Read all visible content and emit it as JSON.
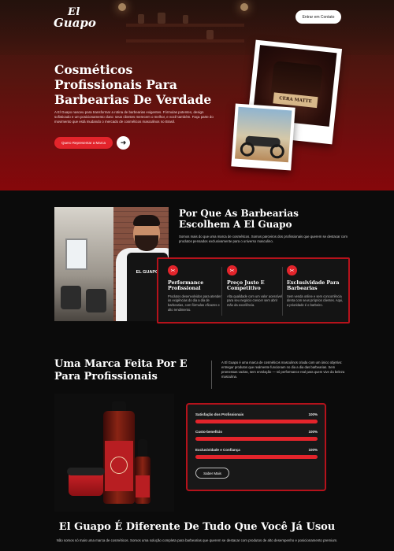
{
  "header": {
    "logo_top": "El",
    "logo_bottom": "Guapo",
    "contact_button": "Entrar em Contato"
  },
  "hero": {
    "title": "Cosméticos Profissionais Para Barbearias De Verdade",
    "text": "A El Guapo nasceu para transformar a rotina de barbearias exigentes. Fórmulas potentes, design sofisticado e um posicionamento claro: seus clientes merecem o melhor, e você também. Faça parte do movimento que está mudando o mercado de cosméticos masculinos no Brasil.",
    "cta_button": "Quero Representar a Marca",
    "arrow_icon": "arrow-right-icon",
    "product_label": "CERA MATTE"
  },
  "why": {
    "title": "Por Que As Barbearias Escolhem A El Guapo",
    "text": "Somos mais do que uma marca de cosméticos. Somos parceiros dos profissionais que querem se destacar com produtos pensados exclusivamente para o universo masculino.",
    "apron_text": "EL GUAPO",
    "features": [
      {
        "icon": "scissors-icon",
        "title": "Performance Profissional",
        "text": "Produtos desenvolvidos para atender às exigências do dia a dia de barbearias, com fórmulas eficazes e alto rendimento."
      },
      {
        "icon": "scissors-icon",
        "title": "Preço Justo E Competitivo",
        "text": "Alta qualidade com um valor acessível para seu negócio crescer sem abrir mão da excelência."
      },
      {
        "icon": "scissors-icon",
        "title": "Exclusividade Para Barbearias",
        "text": "Sem venda online e sem concorrência direta com seus próprios clientes. Aqui, a prioridade é o barbeiro."
      }
    ]
  },
  "brand": {
    "title": "Uma Marca Feita Por E Para Profissionais",
    "text": "A El Guapo é uma marca de cosméticos masculinos criada com um único objetivo: entregar produtos que realmente funcionam no dia a dia das barbearias. Sem promessas vazias, sem enrolação — só performance real para quem vive da beleza masculina.",
    "stats": [
      {
        "label": "Satisfação dos Profissionais",
        "value": "100%",
        "fraction": 1.0
      },
      {
        "label": "Custo-benefício",
        "value": "100%",
        "fraction": 1.0
      },
      {
        "label": "Exclusividade e Confiança",
        "value": "100%",
        "fraction": 1.0
      }
    ],
    "more_button": "Saber Mais"
  },
  "different": {
    "title": "El Guapo É Diferente De Tudo Que Você Já Usou",
    "text": "Não somos só mais uma marca de cosméticos. Somos uma solução completa para barbearias que querem se destacar com produtos de alto desempenho e posicionamento premium."
  },
  "colors": {
    "accent": "#e3242b",
    "border_red": "#b5121b",
    "background": "#0b0b0b"
  }
}
